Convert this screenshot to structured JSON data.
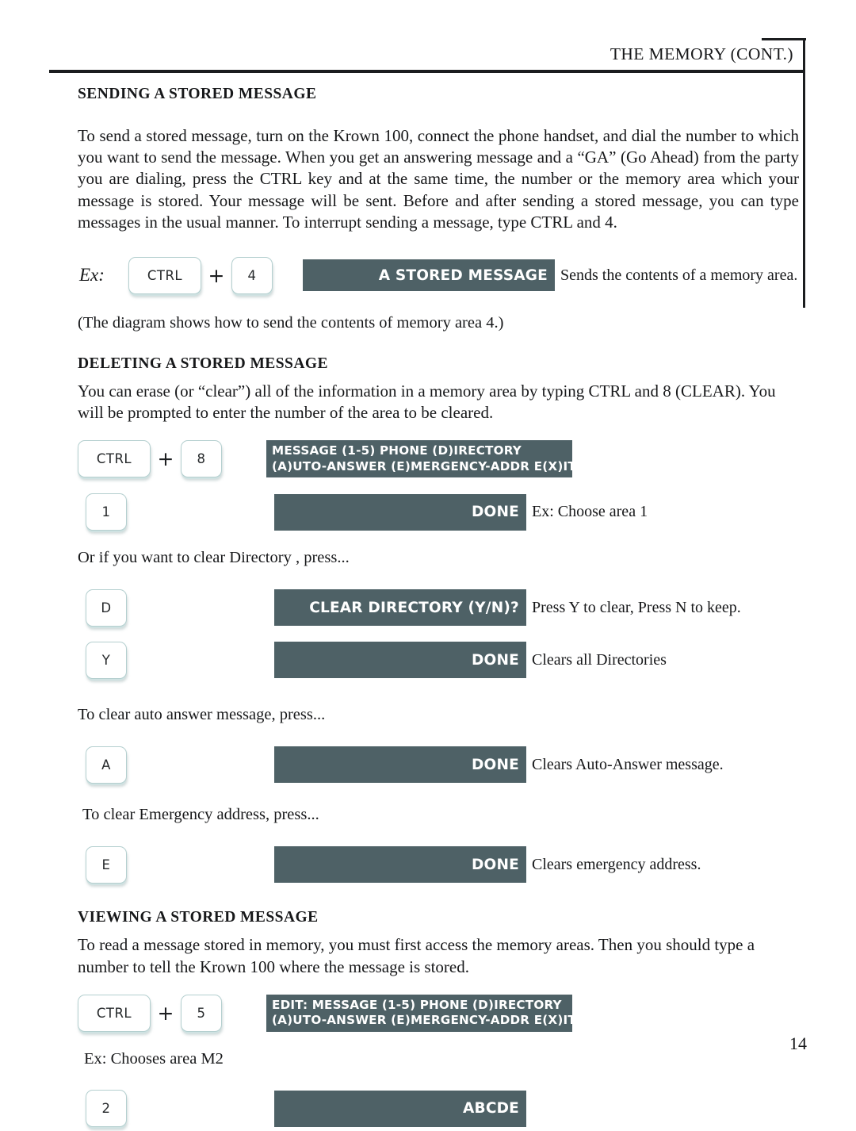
{
  "header": {
    "title": "THE MEMORY (CONT.)"
  },
  "page_number": "14",
  "sections": {
    "sending": {
      "heading": "SENDING A STORED MESSAGE",
      "paragraph": "To send a stored message, turn on the Krown 100, connect the phone handset, and dial the number to which you want to send the message. When you get an answering message and a “GA” (Go Ahead) from the party you are dialing, press the CTRL key and at the same time, the number or the memory area which your message is stored. Your message will be sent. Before and after sending a stored message, you can type messages in the usual manner. To interrupt sending a message, type CTRL and 4.",
      "example_label": "Ex:",
      "key_ctrl": "CTRL",
      "plus": "+",
      "key_num": "4",
      "panel_text": "A STORED MESSAGE",
      "caption": "Sends the contents of a memory area.",
      "note": "(The diagram shows how to send the contents of memory area 4.)"
    },
    "deleting": {
      "heading": "DELETING A STORED MESSAGE",
      "paragraph": "You can erase (or “clear”) all of the information in a memory area by typing CTRL and 8 (CLEAR). You will be prompted to enter the number of the area to be cleared.",
      "row1": {
        "key_ctrl": "CTRL",
        "plus": "+",
        "key_num": "8",
        "panel_line1": "MESSAGE (1-5) PHONE (D)IRECTORY",
        "panel_line2": "(A)UTO-ANSWER (E)MERGENCY-ADDR E(X)IT"
      },
      "row2": {
        "key": "1",
        "panel_text": "DONE",
        "caption": "Ex: Choose area 1"
      },
      "directory_lead": "Or if you want to clear Directory , press...",
      "row3": {
        "key": "D",
        "panel_text": "CLEAR DIRECTORY (Y/N)?",
        "caption": "Press Y to clear, Press N to keep."
      },
      "row4": {
        "key": "Y",
        "panel_text": "DONE",
        "caption": "Clears all Directories"
      },
      "auto_answer_lead": "To clear auto answer message, press...",
      "row5": {
        "key": "A",
        "panel_text": "DONE",
        "caption": "Clears Auto-Answer message."
      },
      "emergency_lead": "To clear Emergency address, press...",
      "row6": {
        "key": "E",
        "panel_text": "DONE",
        "caption": "Clears emergency address."
      }
    },
    "viewing": {
      "heading": "VIEWING A STORED MESSAGE",
      "paragraph": "To read a message stored in memory, you must first access the memory areas. Then you should type a number to tell the Krown 100 where the message is stored.",
      "row1": {
        "key_ctrl": "CTRL",
        "plus": "+",
        "key_num": "5",
        "panel_line1": "EDIT: MESSAGE (1-5) PHONE (D)IRECTORY",
        "panel_line2": "(A)UTO-ANSWER (E)MERGENCY-ADDR E(X)IT"
      },
      "choose_lead": "Ex: Chooses area M2",
      "row2": {
        "key": "2",
        "panel_text": "ABCDE"
      }
    }
  },
  "colors": {
    "panel_background": "#4e6166",
    "panel_text": "#ffffff",
    "key_border": "#b4cfcf",
    "rule": "#1b1d1f",
    "body_text": "#17181a"
  }
}
